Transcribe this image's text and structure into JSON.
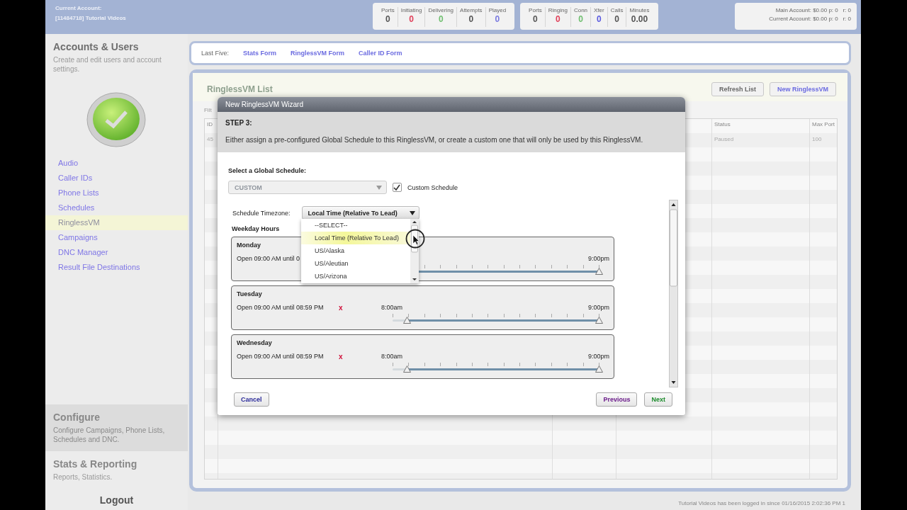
{
  "account": {
    "label": "Current Account:",
    "value": "[11484718] Tutorial Videos"
  },
  "stat_groups": [
    {
      "stats": [
        {
          "label": "Ports",
          "value": "0",
          "color": "#555555"
        },
        {
          "label": "Initiating",
          "value": "0",
          "color": "#e0405a"
        },
        {
          "label": "Delivering",
          "value": "0",
          "color": "#6fbf6f"
        },
        {
          "label": "Attempts",
          "value": "0",
          "color": "#555555"
        },
        {
          "label": "Played",
          "value": "0",
          "color": "#7a7ae0"
        }
      ]
    },
    {
      "stats": [
        {
          "label": "Ports",
          "value": "0",
          "color": "#555555"
        },
        {
          "label": "Ringing",
          "value": "0",
          "color": "#e0405a"
        },
        {
          "label": "Conn",
          "value": "0",
          "color": "#6fbf6f"
        },
        {
          "label": "Xfer",
          "value": "0",
          "color": "#5a5ae0"
        },
        {
          "label": "Calls",
          "value": "0",
          "color": "#555555"
        },
        {
          "label": "Minutes",
          "value": "0.00",
          "color": "#555555"
        }
      ]
    }
  ],
  "balances": [
    {
      "label": "Main Account:",
      "amount": "$0.00",
      "p": "p: 0",
      "r": "r: 0"
    },
    {
      "label": "Current Account:",
      "amount": "$0.00",
      "p": "p: 0",
      "r": "r: 0"
    }
  ],
  "sidebar": {
    "sections": [
      {
        "title": "Accounts & Users",
        "description": "Create and edit users and account settings.",
        "active": true,
        "items": [
          {
            "label": "Audio",
            "selected": false
          },
          {
            "label": "Caller IDs",
            "selected": false
          },
          {
            "label": "Phone Lists",
            "selected": false
          },
          {
            "label": "Schedules",
            "selected": false
          },
          {
            "label": "RinglessVM",
            "selected": true
          },
          {
            "label": "Campaigns",
            "selected": false
          },
          {
            "label": "DNC Manager",
            "selected": false
          },
          {
            "label": "Result File Destinations",
            "selected": false
          }
        ]
      },
      {
        "title": "Configure",
        "description": "Configure Campaigns, Phone Lists, Schedules and DNC.",
        "active": false,
        "highlighted": true
      },
      {
        "title": "Stats & Reporting",
        "description": "Reports, Statistics.",
        "active": false,
        "highlighted": false
      }
    ],
    "logout": "Logout"
  },
  "last_five": {
    "label": "Last Five:",
    "links": [
      "Stats Form",
      "RinglessVM Form",
      "Caller ID Form"
    ]
  },
  "list": {
    "title": "RinglessVM List",
    "buttons": [
      "Refresh List",
      "New RinglessVM"
    ],
    "filter_label": "Filt",
    "columns": [
      "ID",
      "Status",
      "Max Port"
    ],
    "rows": [
      [
        "45",
        "Paused",
        "100"
      ]
    ]
  },
  "wizard": {
    "title": "New RinglessVM Wizard",
    "step": "STEP 3:",
    "description": "Either assign a pre-configured Global Schedule to this RinglessVM, or create a custom one that will only be used by this RinglessVM.",
    "global_schedule_label": "Select a Global Schedule:",
    "global_schedule": {
      "value": "CUSTOM",
      "disabled": true
    },
    "custom_schedule": {
      "label": "Custom Schedule",
      "checked": true
    },
    "timezone": {
      "label": "Schedule Timezone:",
      "value": "Local Time (Relative To Lead)",
      "expanded": true,
      "options": [
        {
          "label": "--SELECT--",
          "selected": false
        },
        {
          "label": "Local Time (Relative To Lead)",
          "selected": true
        },
        {
          "label": "US/Alaska",
          "selected": false
        },
        {
          "label": "US/Aleutian",
          "selected": false
        },
        {
          "label": "US/Arizona",
          "selected": false
        }
      ]
    },
    "weekday_label": "Weekday Hours",
    "days": [
      {
        "name": "Monday",
        "hours": "Open 09:00 AM until 0",
        "end_label": "9:00pm",
        "thumbs": [
          {
            "level": 1
          }
        ]
      },
      {
        "name": "Tuesday",
        "hours": "Open 09:00 AM until 08:59 PM",
        "remove": "x",
        "start_label": "8:00am",
        "end_label": "9:00pm",
        "thumbs": [
          {
            "level": 0.07
          },
          {
            "level": 1
          }
        ]
      },
      {
        "name": "Wednesday",
        "hours": "Open 09:00 AM until 08:59 PM",
        "remove": "x",
        "start_label": "8:00am",
        "end_label": "9:00pm",
        "thumbs": [
          {
            "level": 0.07
          },
          {
            "level": 1
          }
        ]
      }
    ],
    "buttons": {
      "cancel": "Cancel",
      "previous": "Previous",
      "next": "Next"
    }
  },
  "footer": "Tutorial Videos has been logged in since 01/16/2015 2:02:36 PM 1"
}
